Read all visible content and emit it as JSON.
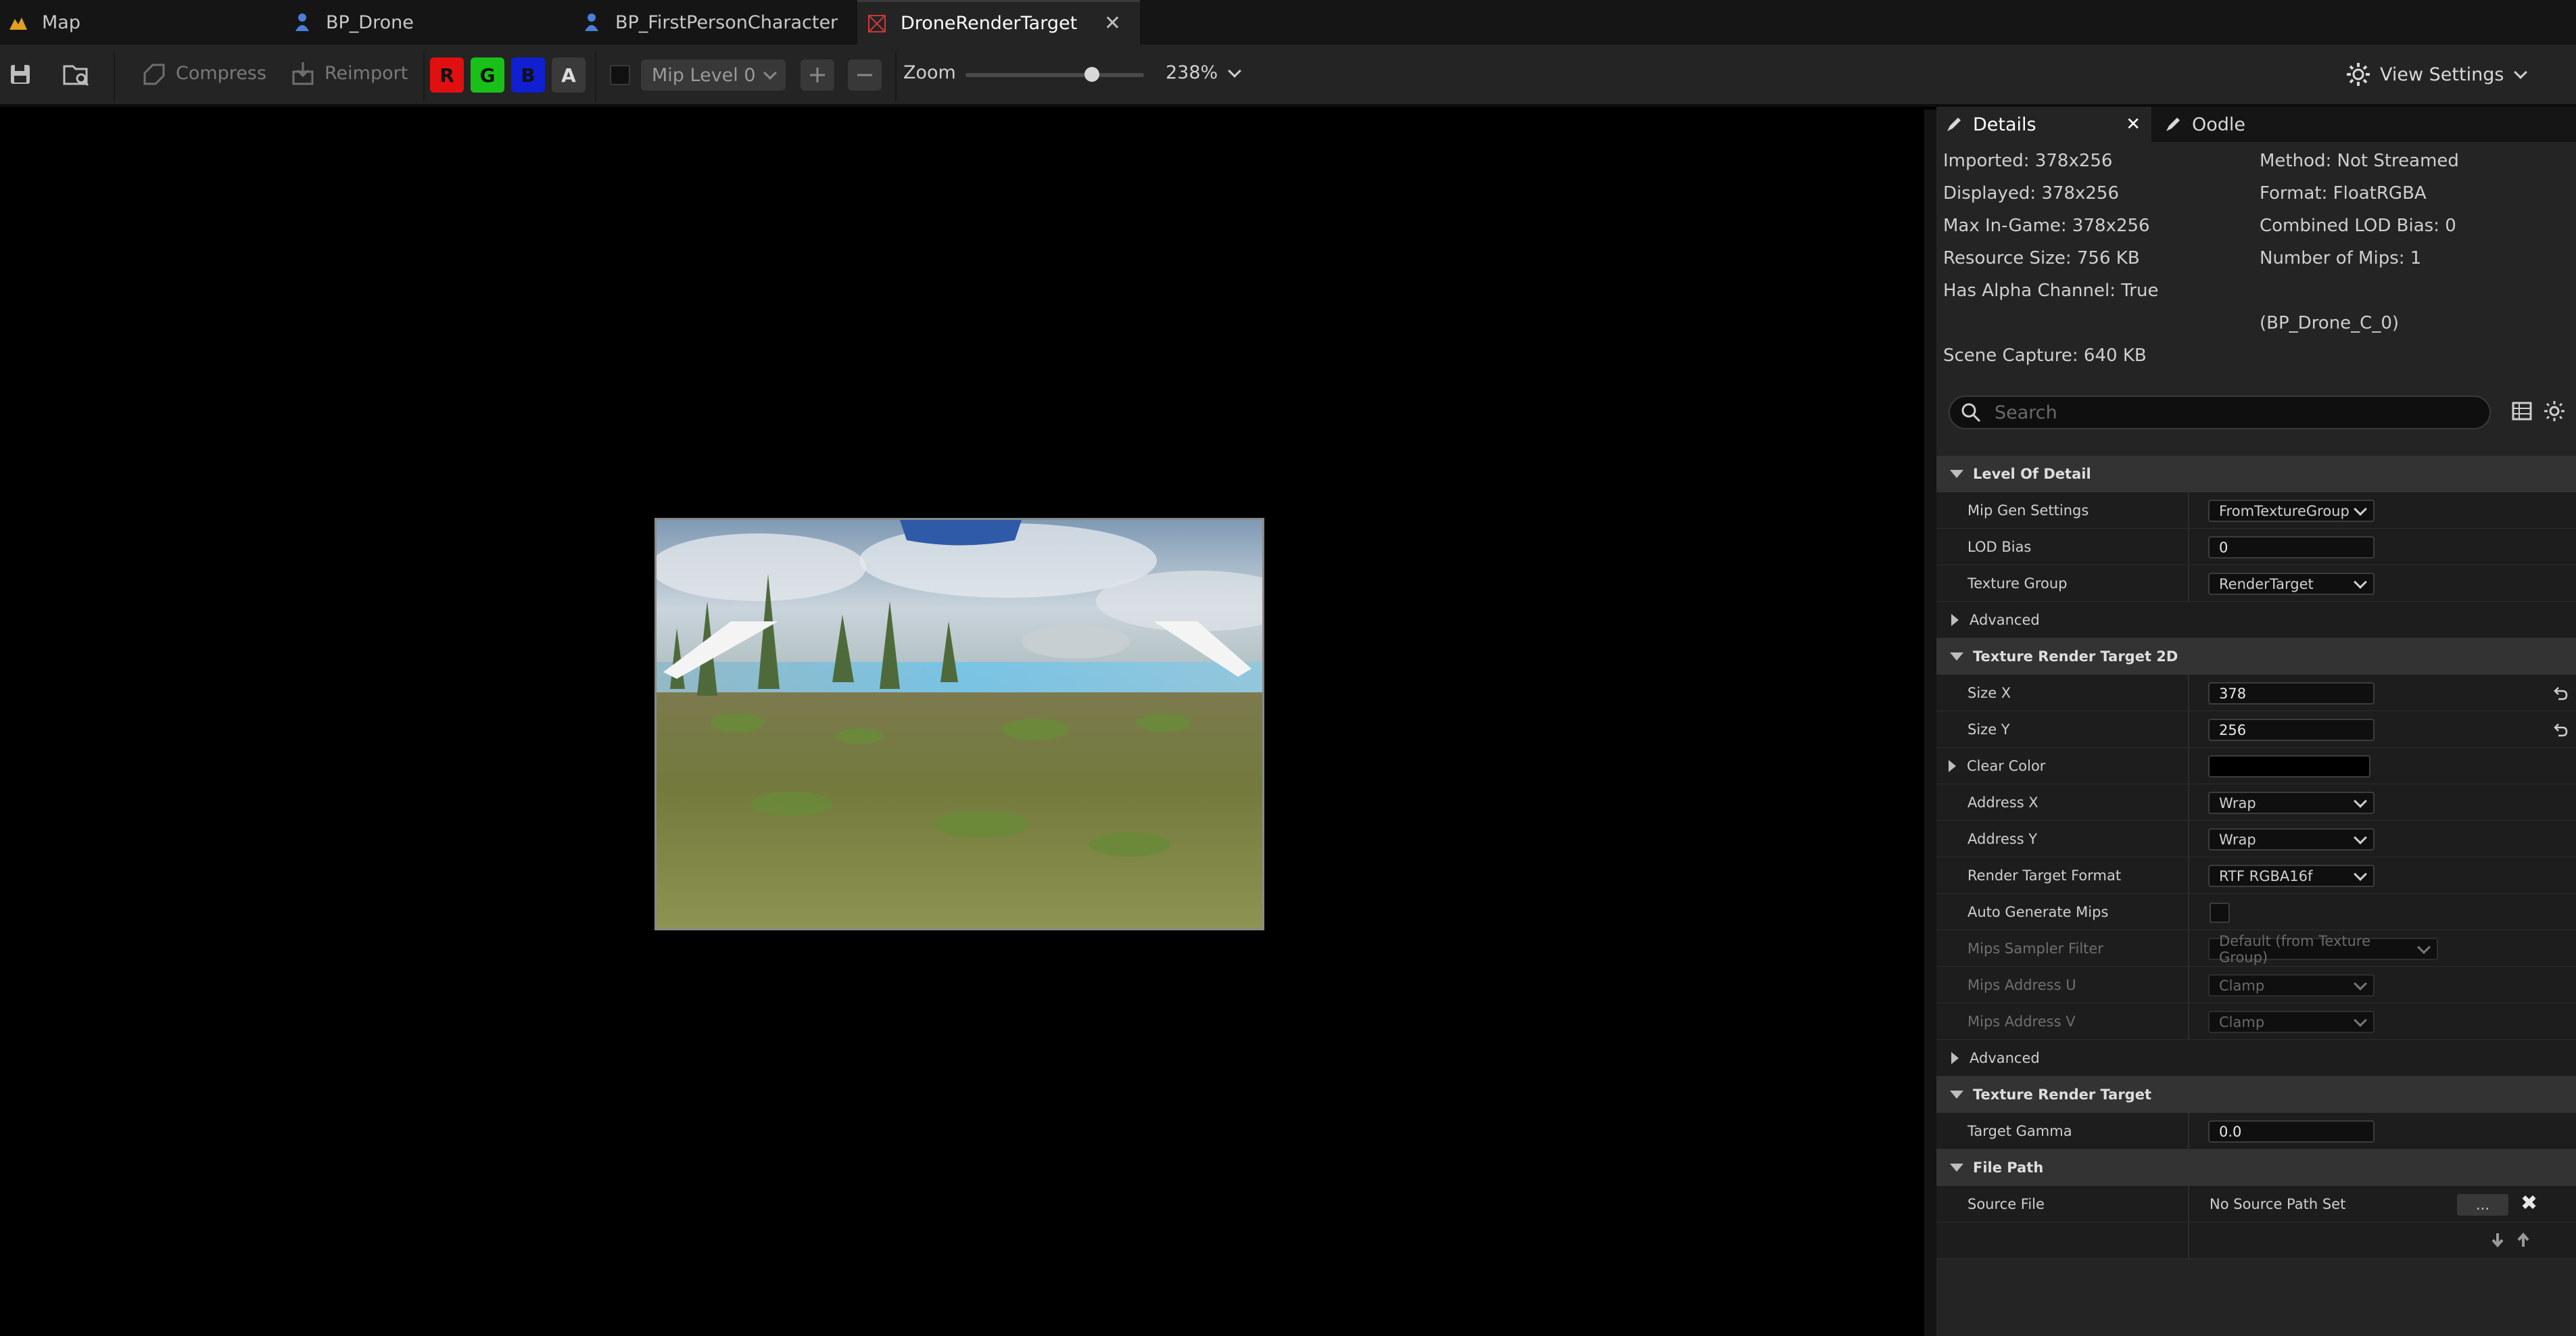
{
  "tabs": [
    {
      "label": "Map",
      "icon": "map-icon"
    },
    {
      "label": "BP_Drone",
      "icon": "blueprint-icon"
    },
    {
      "label": "BP_FirstPersonCharacter",
      "icon": "blueprint-icon"
    },
    {
      "label": "DroneRenderTarget",
      "icon": "render-target-icon",
      "active": true
    }
  ],
  "toolbar": {
    "compress_label": "Compress",
    "reimport_label": "Reimport",
    "channels": [
      {
        "label": "R",
        "color": "#e01010"
      },
      {
        "label": "G",
        "color": "#18c018"
      },
      {
        "label": "B",
        "color": "#1020d0"
      },
      {
        "label": "A",
        "color": "#3a3a3a"
      }
    ],
    "mip_level": "Mip Level 0",
    "zoom_label": "Zoom",
    "zoom_value": "238%",
    "zoom_slider_fraction": 0.71,
    "view_settings_label": "View Settings"
  },
  "details": {
    "tab_details": "Details",
    "tab_oodle": "Oodle",
    "info_left": [
      "Imported: 378x256",
      "Displayed: 378x256",
      "Max In-Game: 378x256",
      "Resource Size: 756 KB",
      "Has Alpha Channel: True"
    ],
    "info_right": [
      "Method: Not Streamed",
      "Format: FloatRGBA",
      "Combined LOD Bias: 0",
      "Number of Mips: 1"
    ],
    "owner": "(BP_Drone_C_0)",
    "scene_capture": "Scene Capture: 640 KB",
    "search_placeholder": "Search",
    "sections": {
      "lod": "Level Of Detail",
      "rt2d": "Texture Render Target 2D",
      "rt": "Texture Render Target",
      "filepath": "File Path"
    },
    "advanced_label": "Advanced",
    "props": {
      "mip_gen_settings": {
        "label": "Mip Gen Settings",
        "value": "FromTextureGroup"
      },
      "lod_bias": {
        "label": "LOD Bias",
        "value": "0"
      },
      "texture_group": {
        "label": "Texture Group",
        "value": "RenderTarget"
      },
      "size_x": {
        "label": "Size X",
        "value": "378"
      },
      "size_y": {
        "label": "Size Y",
        "value": "256"
      },
      "clear_color": {
        "label": "Clear Color",
        "value": "#000000"
      },
      "address_x": {
        "label": "Address X",
        "value": "Wrap"
      },
      "address_y": {
        "label": "Address Y",
        "value": "Wrap"
      },
      "render_target_format": {
        "label": "Render Target Format",
        "value": "RTF RGBA16f"
      },
      "auto_generate_mips": {
        "label": "Auto Generate Mips",
        "checked": false
      },
      "mips_sampler_filter": {
        "label": "Mips Sampler Filter",
        "value": "Default (from Texture Group)"
      },
      "mips_address_u": {
        "label": "Mips Address U",
        "value": "Clamp"
      },
      "mips_address_v": {
        "label": "Mips Address V",
        "value": "Clamp"
      },
      "target_gamma": {
        "label": "Target Gamma",
        "value": "0.0"
      },
      "source_file": {
        "label": "Source File",
        "value": "No Source Path Set",
        "browse_label": "..."
      }
    }
  }
}
